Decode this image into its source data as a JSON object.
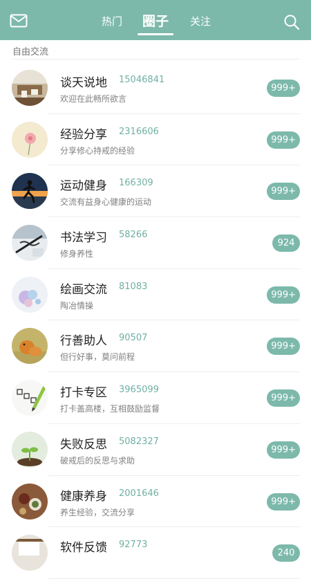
{
  "header": {
    "tabs": [
      "热门",
      "圈子",
      "关注"
    ],
    "active_tab": "圈子",
    "left_icon": "mail-icon",
    "right_icon": "search-icon"
  },
  "section": {
    "title": "自由交流"
  },
  "colors": {
    "accent": "#7cb9ab",
    "count_text": "#6fb0a3"
  },
  "circles": [
    {
      "name": "谈天说地",
      "count": "15046841",
      "desc": "欢迎在此畅所欲言",
      "badge": "999+"
    },
    {
      "name": "经验分享",
      "count": "2316606",
      "desc": "分享修心持戒的经验",
      "badge": "999+"
    },
    {
      "name": "运动健身",
      "count": "166309",
      "desc": "交流有益身心健康的运动",
      "badge": "999+"
    },
    {
      "name": "书法学习",
      "count": "58266",
      "desc": "修身养性",
      "badge": "924"
    },
    {
      "name": "绘画交流",
      "count": "81083",
      "desc": "陶冶情操",
      "badge": "999+"
    },
    {
      "name": "行善助人",
      "count": "90507",
      "desc": "但行好事，莫问前程",
      "badge": "999+"
    },
    {
      "name": "打卡专区",
      "count": "3965099",
      "desc": "打卡盖高楼，互相鼓励监督",
      "badge": "999+"
    },
    {
      "name": "失败反思",
      "count": "5082327",
      "desc": "破戒后的反思与求助",
      "badge": "999+"
    },
    {
      "name": "健康养身",
      "count": "2001646",
      "desc": "养生经验，交流分享",
      "badge": "999+"
    },
    {
      "name": "软件反馈",
      "count": "92773",
      "desc": "",
      "badge": "240"
    }
  ]
}
